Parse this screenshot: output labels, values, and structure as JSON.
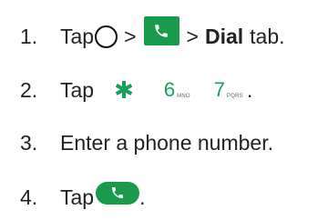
{
  "steps": [
    {
      "number": "1.",
      "text_a": "Tap",
      "text_b": ">",
      "text_c": ">",
      "bold": "Dial",
      "text_d": "tab."
    },
    {
      "number": "2.",
      "text_a": "Tap",
      "text_end": "."
    },
    {
      "number": "3.",
      "text": "Enter a phone number."
    },
    {
      "number": "4.",
      "text_a": "Tap",
      "text_end": "."
    }
  ],
  "keys": [
    {
      "digit": "6",
      "letters": "MNO"
    },
    {
      "digit": "7",
      "letters": "PQRS"
    }
  ],
  "key_star": "✱",
  "icons": {
    "home": "circle-icon",
    "phone_app": "phone-app-icon",
    "call_button": "call-button-icon"
  },
  "colors": {
    "accent": "#1a9b4b",
    "text": "#222222"
  }
}
